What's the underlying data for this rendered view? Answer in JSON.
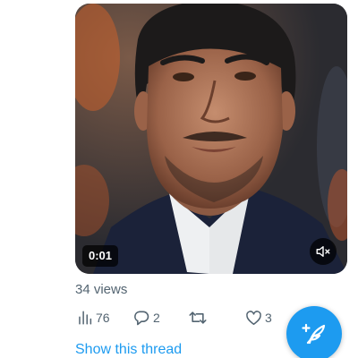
{
  "media": {
    "timestamp": "0:01",
    "mute_icon": "speaker-muted-icon"
  },
  "tweet": {
    "views_text": "34 views",
    "analytics": {
      "icon": "analytics-bar-icon",
      "count": "76"
    },
    "replies": {
      "icon": "reply-bubble-icon",
      "count": "2"
    },
    "retweets": {
      "icon": "retweet-icon",
      "count": ""
    },
    "likes": {
      "icon": "heart-icon",
      "count": "3"
    },
    "show_thread": "Show this thread"
  },
  "compose": {
    "icon": "feather-plus-icon"
  },
  "colors": {
    "accent": "#1d9bf0",
    "secondary_text": "#536471",
    "background": "#ffffff"
  }
}
